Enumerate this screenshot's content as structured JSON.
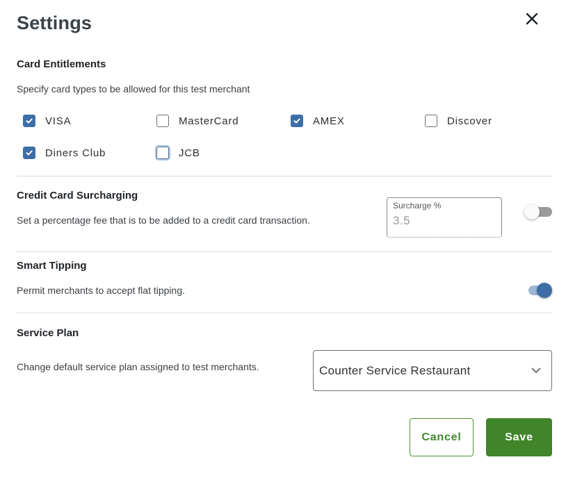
{
  "header": {
    "title": "Settings",
    "close_icon": "close-icon"
  },
  "card_entitlements": {
    "title": "Card Entitlements",
    "description": "Specify card types to be allowed for this test merchant",
    "cards": [
      {
        "label": "VISA",
        "checked": true,
        "focused": false
      },
      {
        "label": "MasterCard",
        "checked": false,
        "focused": false
      },
      {
        "label": "AMEX",
        "checked": true,
        "focused": false
      },
      {
        "label": "Discover",
        "checked": false,
        "focused": false
      },
      {
        "label": "Diners Club",
        "checked": true,
        "focused": false
      },
      {
        "label": "JCB",
        "checked": false,
        "focused": true
      }
    ]
  },
  "surcharging": {
    "title": "Credit Card Surcharging",
    "description": "Set a percentage fee that is to be added to a credit card transaction.",
    "field_label": "Surcharge %",
    "field_value": "3.5",
    "enabled": false
  },
  "smart_tipping": {
    "title": "Smart Tipping",
    "description": "Permit merchants to accept flat tipping.",
    "enabled": true
  },
  "service_plan": {
    "title": "Service Plan",
    "description": "Change default service plan assigned to test merchants.",
    "selected": "Counter Service Restaurant"
  },
  "actions": {
    "cancel_label": "Cancel",
    "save_label": "Save"
  },
  "colors": {
    "checkbox_accent": "#3e6ea8",
    "primary_green": "#408529"
  }
}
